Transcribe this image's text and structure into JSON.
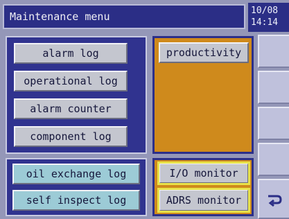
{
  "header": {
    "title": "Maintenance menu",
    "clock_line1": "10/08",
    "clock_line2": "14:14"
  },
  "left_menu": {
    "items": [
      {
        "label": "alarm log"
      },
      {
        "label": "operational log"
      },
      {
        "label": "alarm counter"
      },
      {
        "label": "component log"
      }
    ]
  },
  "left_bottom_menu": {
    "items": [
      {
        "label": "oil exchange log"
      },
      {
        "label": "self inspect log"
      }
    ]
  },
  "right_menu": {
    "productivity_label": "productivity",
    "io_monitor_label": "I/O monitor",
    "adrs_monitor_label": "ADRS monitor"
  },
  "side": {
    "return_icon": "return-arrow-icon"
  },
  "colors": {
    "title_bg": "#2b2e86",
    "panel_blue": "#30338f",
    "panel_orange": "#cf8a1c",
    "button_gray": "#c4c6cf",
    "button_teal": "#9ccbd6",
    "highlight_yellow": "#e8e24a"
  }
}
